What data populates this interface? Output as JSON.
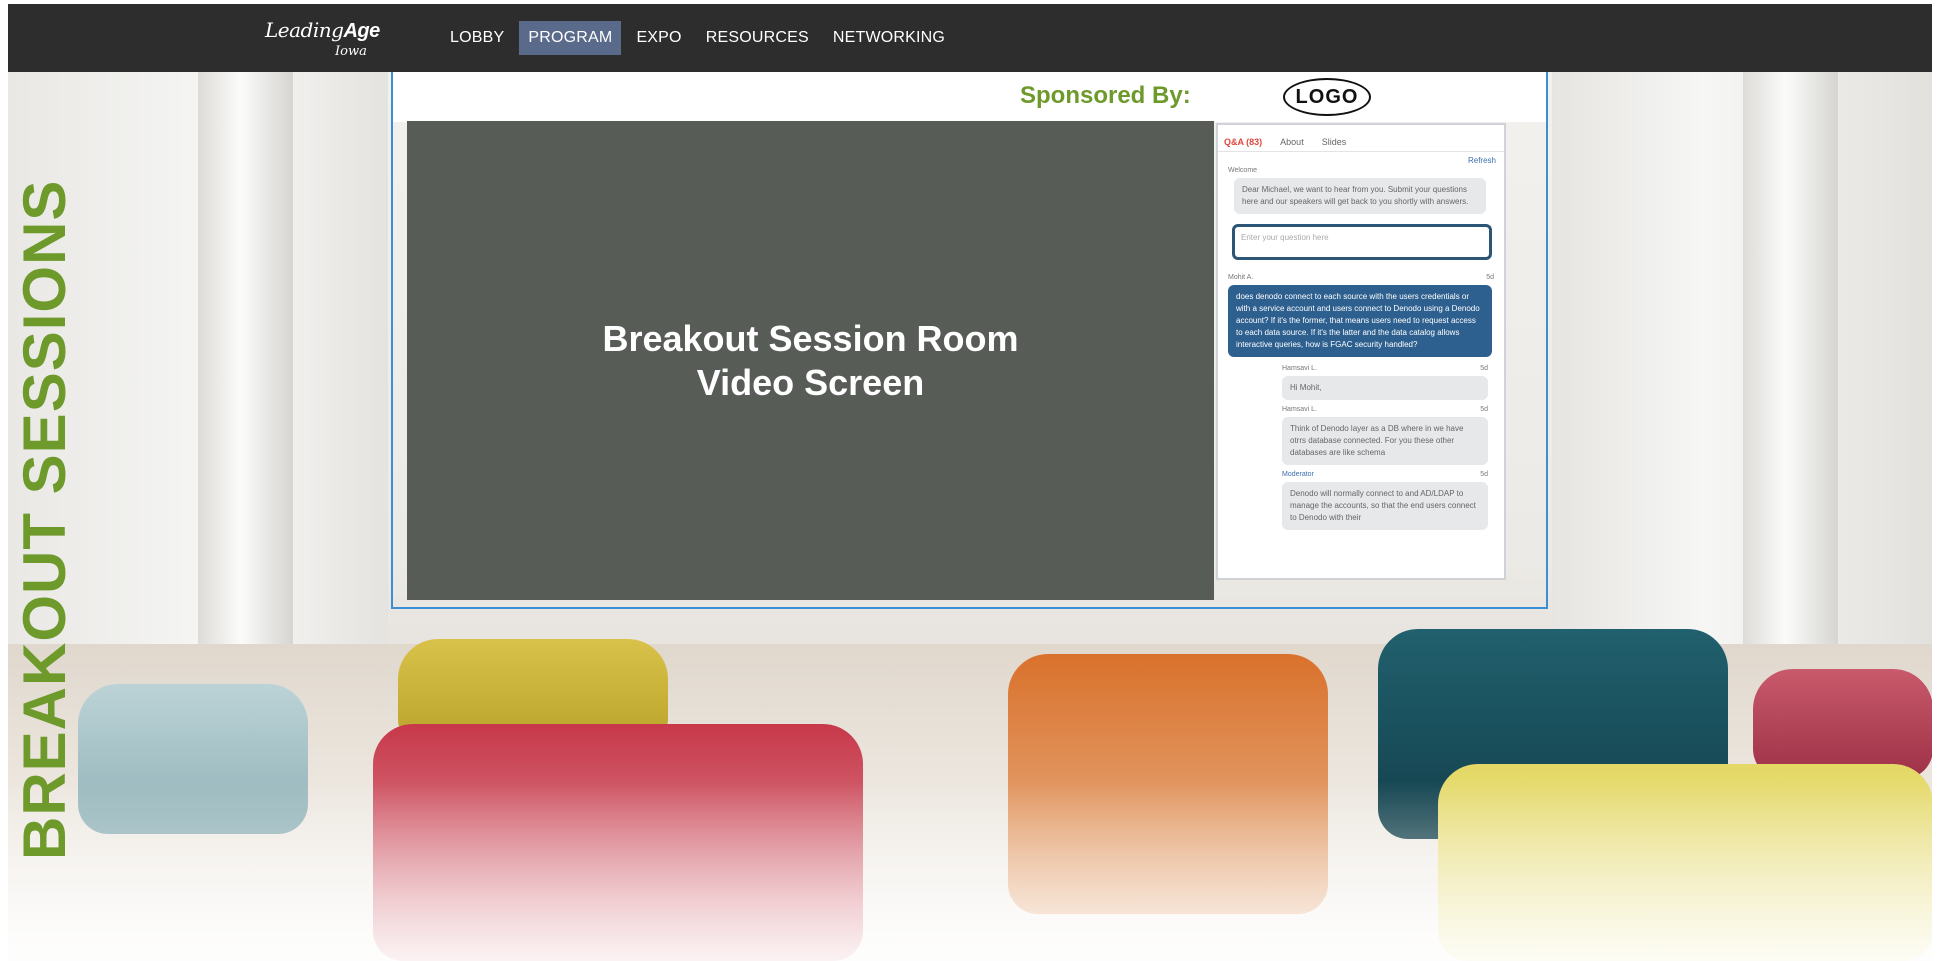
{
  "colors": {
    "navbar_bg": "#2d2d2d",
    "nav_active_bg": "#5a6a8b",
    "accent_green": "#6e9a2b",
    "frame_blue": "#3b8fd4",
    "video_bg": "#575c57",
    "question_bubble": "#2d5f8f",
    "qa_active_tab": "#e0463e"
  },
  "brand": {
    "main_light": "Leading",
    "main_bold": "Age",
    "sub": "Iowa"
  },
  "nav": {
    "items": [
      {
        "label": "LOBBY",
        "active": false
      },
      {
        "label": "PROGRAM",
        "active": true
      },
      {
        "label": "EXPO",
        "active": false
      },
      {
        "label": "RESOURCES",
        "active": false
      },
      {
        "label": "NETWORKING",
        "active": false
      }
    ]
  },
  "sponsor": {
    "label": "Sponsored By:",
    "logo_text": "LOGO"
  },
  "video": {
    "line1": "Breakout Session Room",
    "line2": "Video Screen"
  },
  "side_title": "BREAKOUT SESSIONS",
  "qa_panel": {
    "tabs": [
      "Q&A (83)",
      "About",
      "Slides"
    ],
    "refresh": "Refresh",
    "welcome_label": "Welcome",
    "welcome_text": "Dear Michael, we want to hear from you. Submit your questions here and our speakers will get back to you shortly with answers.",
    "input_placeholder": "Enter your question here",
    "question": {
      "author": "Mohit A.",
      "meta": "5d",
      "text": "does denodo connect to each source with the users credentials or with a service account and users connect to Denodo using a Denodo account? If it's the former, that means users need to request access to each data source. If it's the latter and the data catalog allows interactive queries, how is FGAC security handled?"
    },
    "replies": [
      {
        "author": "Hamsavi L.",
        "meta": "5d",
        "text": "Hi Mohit,"
      },
      {
        "author": "Hamsavi L.",
        "meta": "5d",
        "text": "Think of Denodo layer as a DB where in we have otrrs database connected. For you these other databases are like schema"
      },
      {
        "author": "Moderator",
        "meta": "5d",
        "text": "Denodo will normally connect to and AD/LDAP to manage the accounts, so that the end users connect to Denodo with their"
      }
    ]
  }
}
